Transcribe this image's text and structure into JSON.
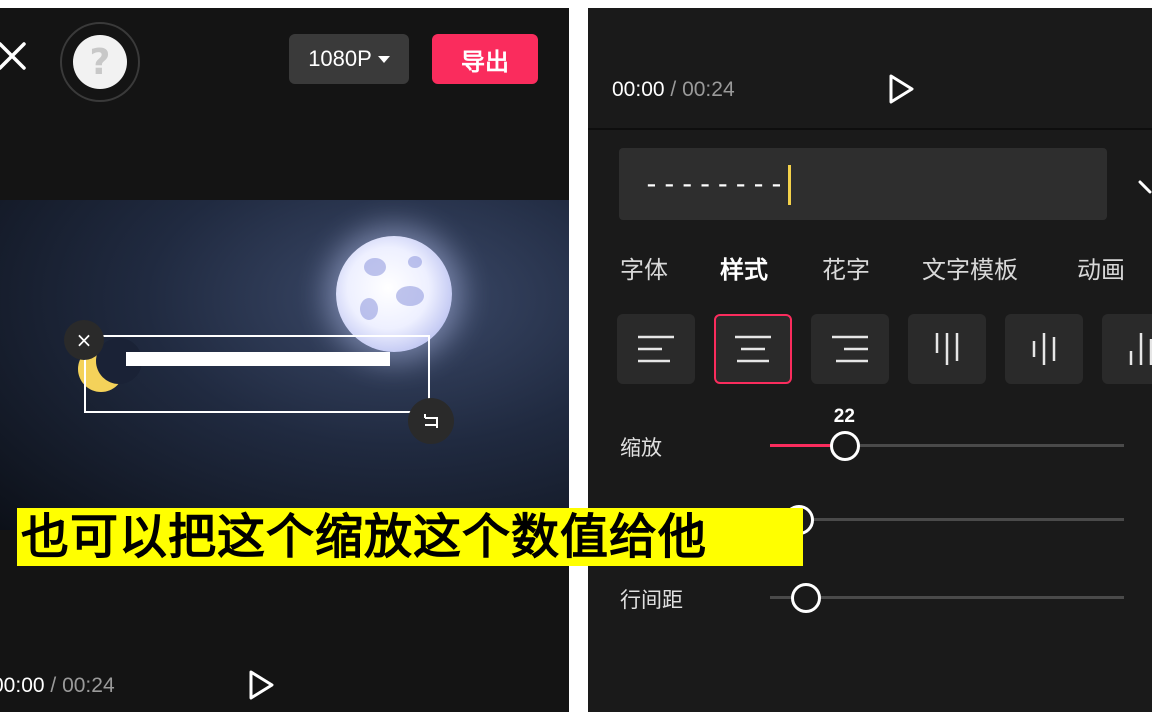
{
  "left": {
    "resolution_label": "1080P",
    "export_label": "导出",
    "help_glyph": "?",
    "box_close_glyph": "×",
    "time_current": "00:00",
    "time_separator": " / ",
    "time_total": "00:24",
    "preview_bar_color": "#ffffff"
  },
  "right": {
    "time_current": "00:00",
    "time_separator": " / ",
    "time_total": "00:24",
    "text_input_value": "--------",
    "tabs": [
      "字体",
      "样式",
      "花字",
      "文字模板",
      "动画"
    ],
    "active_tab": "样式",
    "alignment_options": [
      "align-left",
      "align-center",
      "align-right",
      "vertical-top",
      "vertical-center",
      "vertical-bottom"
    ],
    "selected_alignment": "align-center",
    "sliders": [
      {
        "label": "缩放",
        "value_label": "22",
        "value_fraction": 0.21
      },
      {
        "label": "",
        "value_label": "",
        "value_fraction": 0.08
      },
      {
        "label": "行间距",
        "value_label": "",
        "value_fraction": 0.1
      }
    ]
  },
  "caption": {
    "text": "也可以把这个缩放这个数值给他"
  },
  "colors": {
    "accent": "#fa2c5d",
    "panel_bg": "#141414",
    "caption_bg": "#ffff00",
    "cursor": "#f3d14a"
  }
}
